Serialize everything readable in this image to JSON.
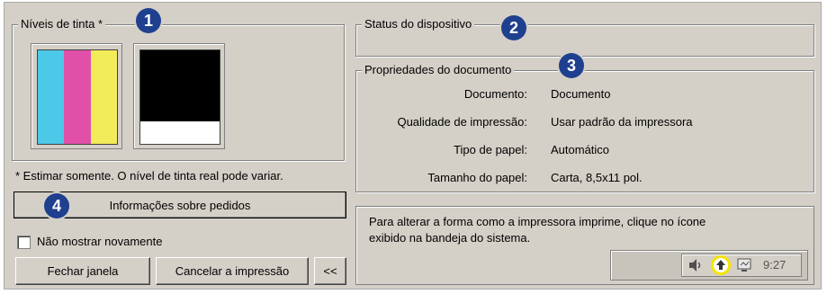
{
  "ink_levels": {
    "title": "Níveis de tinta *",
    "badge": "1",
    "color_cartridge_colors": [
      "#4cc8e8",
      "#e050a8",
      "#f2ec5a"
    ],
    "black_cartridge": {
      "fill_color": "#000000",
      "level_fraction": 0.76
    }
  },
  "note": "* Estimar somente.  O nível de tinta real pode variar.",
  "order_info": {
    "badge": "4",
    "button_label": "Informações sobre pedidos"
  },
  "dont_show": {
    "label": "Não mostrar novamente",
    "checked": false
  },
  "buttons": {
    "close": "Fechar janela",
    "cancel": "Cancelar a impressão",
    "collapse": "<<"
  },
  "device_status": {
    "title": "Status do dispositivo",
    "badge": "2"
  },
  "document_properties": {
    "title": "Propriedades do documento",
    "badge": "3",
    "rows": [
      {
        "label": "Documento:",
        "value": "Documento"
      },
      {
        "label": "Qualidade de impressão:",
        "value": "Usar padrão da impressora"
      },
      {
        "label": "Tipo de papel:",
        "value": "Automático"
      },
      {
        "label": "Tamanho do papel:",
        "value": "Carta, 8,5x11 pol."
      }
    ]
  },
  "tray_hint": {
    "text_line1": "Para alterar a forma como a impressora imprime, clique no ícone",
    "text_line2": "exibido na bandeja do sistema.",
    "clock": "9:27",
    "highlight_color": "#f5e400"
  }
}
